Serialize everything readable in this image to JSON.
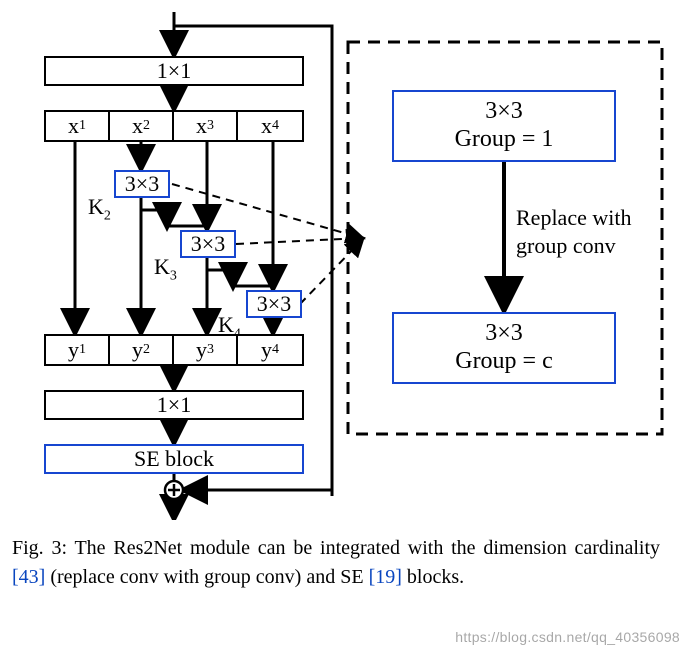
{
  "figure": {
    "conv1x1_top": "1×1",
    "conv1x1_bot": "1×1",
    "se_block": "SE block",
    "splits": {
      "x1": "x",
      "x1s": "1",
      "x2": "x",
      "x2s": "2",
      "x3": "x",
      "x3s": "3",
      "x4": "x",
      "x4s": "4"
    },
    "merges": {
      "y1": "y",
      "y1s": "1",
      "y2": "y",
      "y2s": "2",
      "y3": "y",
      "y3s": "3",
      "y4": "y",
      "y4s": "4"
    },
    "conv3x3": "3×3",
    "k2": "K",
    "k2s": "2",
    "k3": "K",
    "k3s": "3",
    "k4": "K",
    "k4s": "4",
    "detail_top_a": "3×3",
    "detail_top_b": "Group = 1",
    "detail_bot_a": "3×3",
    "detail_bot_b": "Group = c",
    "replace_a": "Replace with",
    "replace_b": "group conv"
  },
  "caption": {
    "prefix": "Fig. 3: The Res2Net module can be integrated with the dimension cardinality ",
    "ref1": "[43]",
    "mid": " (replace conv with group conv) and SE ",
    "ref2": "[19]",
    "suffix": " blocks."
  },
  "watermark": "https://blog.csdn.net/qq_40356098"
}
